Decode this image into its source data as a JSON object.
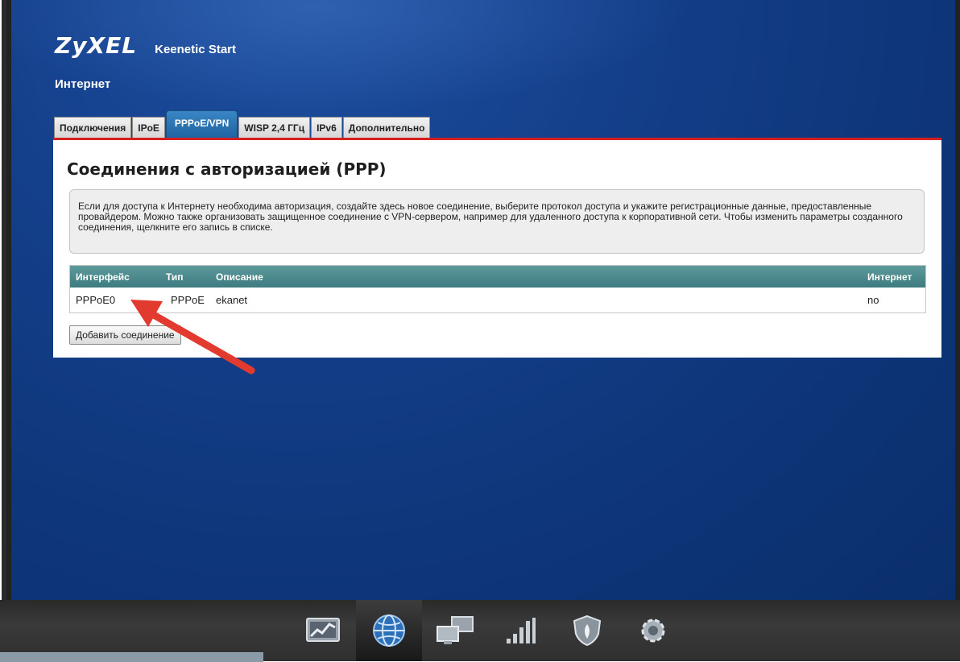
{
  "header": {
    "brand": "ZyXEL",
    "product": "Keenetic Start",
    "section_title": "Интернет"
  },
  "tabs": [
    {
      "label": "Подключения"
    },
    {
      "label": "IPoE"
    },
    {
      "label": "PPPoE/VPN",
      "active": true
    },
    {
      "label": "WISP 2,4 ГГц"
    },
    {
      "label": "IPv6"
    },
    {
      "label": "Дополнительно"
    }
  ],
  "panel": {
    "heading": "Соединения с авторизацией (PPP)",
    "info": "Если для доступа к Интернету необходима авторизация, создайте здесь новое соединение, выберите протокол доступа и укажите регистрационные данные, предоставленные провайдером. Можно также организовать защищенное соединение с VPN-сервером, например для удаленного доступа к корпоративной сети. Чтобы изменить параметры созданного соединения, щелкните его запись в списке."
  },
  "table": {
    "columns": [
      "Интерфейс",
      "Тип",
      "Описание",
      "Интернет"
    ],
    "rows": [
      {
        "interface": "PPPoE0",
        "type": "PPPoE",
        "description": "ekanet",
        "internet": "no"
      }
    ]
  },
  "add_button": "Добавить соединение",
  "annotation": {
    "arrow_color": "#e23a2e"
  },
  "bottom_nav": [
    {
      "icon": "monitor-chart-icon"
    },
    {
      "icon": "globe-icon",
      "active": true
    },
    {
      "icon": "network-computers-icon"
    },
    {
      "icon": "wifi-signal-icon"
    },
    {
      "icon": "shield-icon"
    },
    {
      "icon": "gear-icon"
    }
  ],
  "colors": {
    "background": "#0f3a80",
    "tab_active": "#2a74b8",
    "accent_red": "#d62020",
    "table_header": "#4a8a8e"
  }
}
